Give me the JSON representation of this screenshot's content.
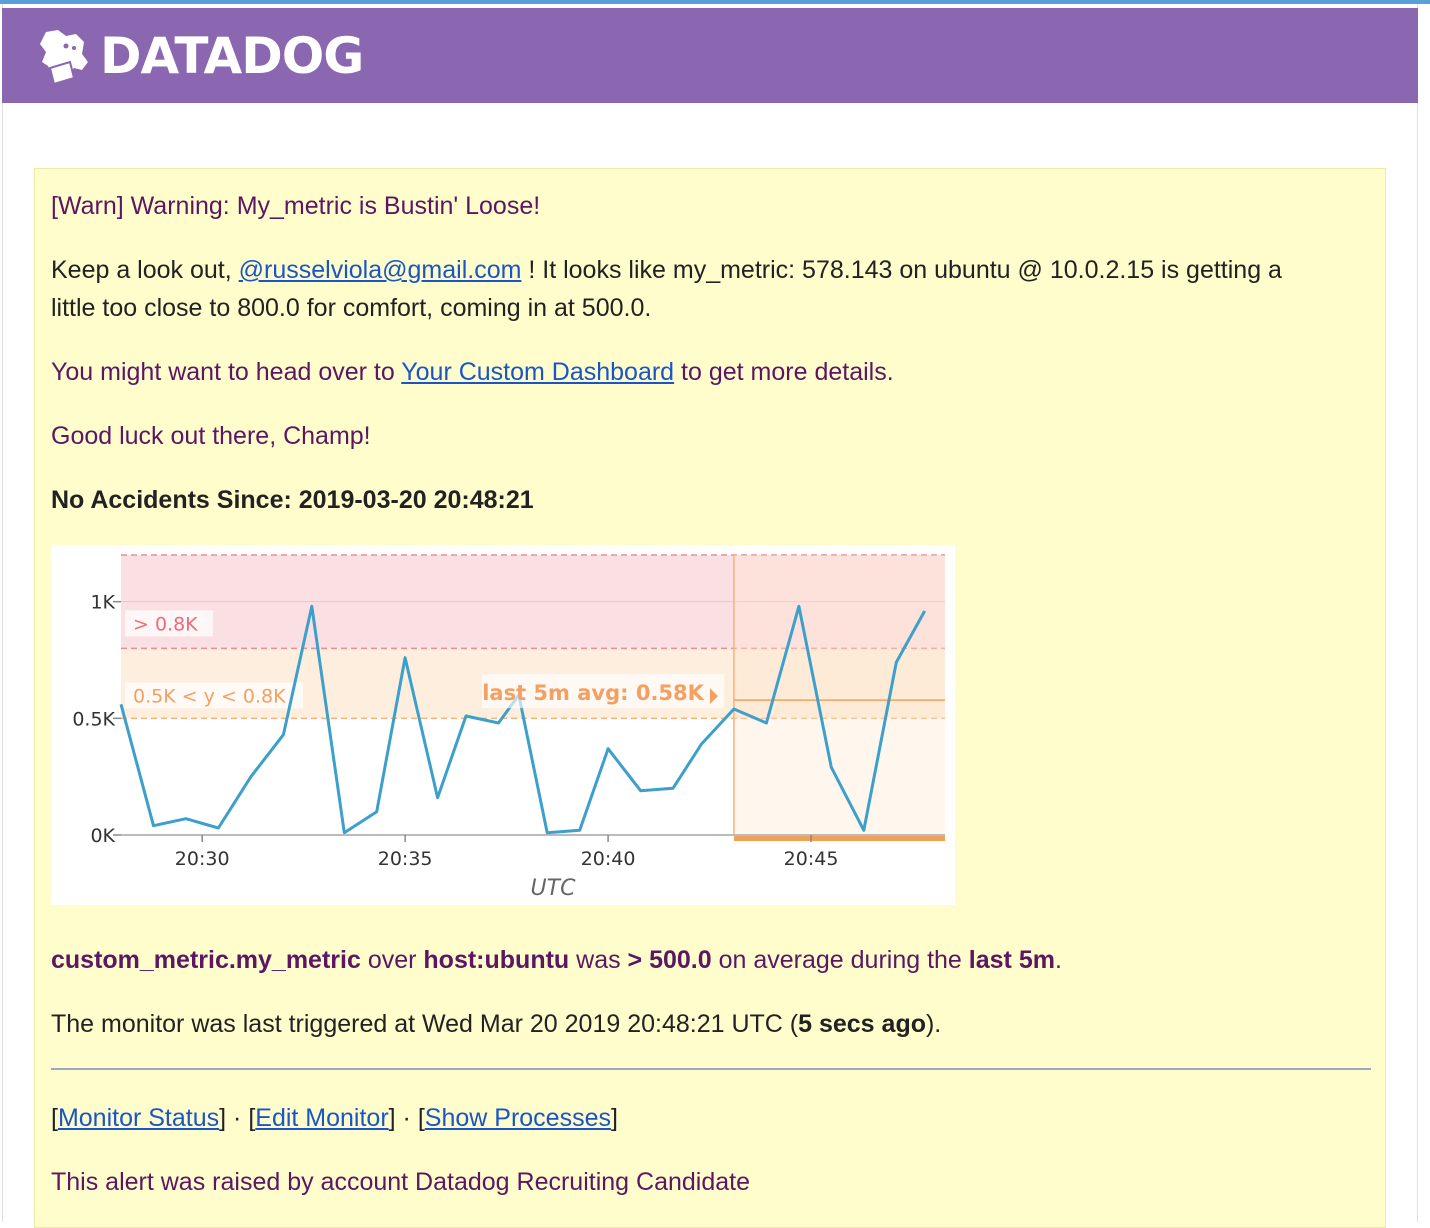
{
  "header": {
    "brand": "DATADOG",
    "logo_icon": "datadog-dog-icon"
  },
  "email": {
    "title": "[Warn] Warning: My_metric is Bustin' Loose!",
    "intro_before": "Keep a look out, ",
    "mention": "@russelviola@gmail.com",
    "intro_after_1": " ! It looks like my_metric: 578.143 on ubuntu @ 10.0.2.15 is getting a",
    "intro_after_2": "little too close to 800.0 for comfort, coming in at 500.0.",
    "dash_before": "You might want to head over to ",
    "dash_link": "Your Custom Dashboard",
    "dash_after": " to get more details.",
    "good_luck": "Good luck out there, Champ!",
    "no_accidents": "No Accidents Since: 2019-03-20 20:48:21",
    "summary": {
      "metric": "custom_metric.my_metric",
      "over": " over ",
      "host": "host:ubuntu",
      "was": " was ",
      "threshold": "> 500.0",
      "avg": " on average during the ",
      "window": "last 5m",
      "end": "."
    },
    "triggered_before": "The monitor was last triggered at Wed Mar 20 2019 20:48:21 UTC (",
    "triggered_ago": "5 secs ago",
    "triggered_after": ").",
    "links": [
      {
        "label": "Monitor Status"
      },
      {
        "label": "Edit Monitor"
      },
      {
        "label": "Show Processes"
      }
    ],
    "link_sep": " · ",
    "raised_by": "This alert was raised by account Datadog Recruiting Candidate"
  },
  "chart_data": {
    "type": "line",
    "xlabel": "UTC",
    "ylabel": "",
    "x_ticks": [
      {
        "label": "20:30",
        "t": 2.0
      },
      {
        "label": "20:35",
        "t": 7.0
      },
      {
        "label": "20:40",
        "t": 12.0
      },
      {
        "label": "20:45",
        "t": 17.0
      }
    ],
    "y_ticks": [
      {
        "label": "0K",
        "v": 0
      },
      {
        "label": "0.5K",
        "v": 500
      },
      {
        "label": "1K",
        "v": 1000
      }
    ],
    "xlim": [
      0,
      20.3
    ],
    "ylim": [
      0,
      1200
    ],
    "thresholds": [
      {
        "label": "> 0.8K",
        "from": 800,
        "to": 1200,
        "color": "#fbe0e3",
        "line": "#f08c96",
        "text_color": "#ef6b7a"
      },
      {
        "label": "0.5K < y < 0.8K",
        "from": 500,
        "to": 800,
        "color": "#fdeede",
        "line": "#f5b479",
        "text_color": "#f3a060"
      }
    ],
    "eval_window_start": 15.1,
    "avg_label": "last 5m avg: 0.58K",
    "avg_value": 578,
    "series": [
      {
        "color": "#3d9fcb",
        "x": [
          0.0,
          0.8,
          1.6,
          2.4,
          3.2,
          4.0,
          4.7,
          5.5,
          6.3,
          7.0,
          7.8,
          8.5,
          9.3,
          9.8,
          10.5,
          11.3,
          12.0,
          12.8,
          13.6,
          14.3,
          15.1,
          15.9,
          16.7,
          17.5,
          18.3,
          19.1,
          19.8
        ],
        "y": [
          560,
          40,
          70,
          30,
          250,
          430,
          980,
          10,
          100,
          760,
          160,
          510,
          480,
          600,
          10,
          20,
          370,
          190,
          200,
          390,
          540,
          480,
          980,
          290,
          20,
          740,
          960
        ]
      }
    ]
  }
}
